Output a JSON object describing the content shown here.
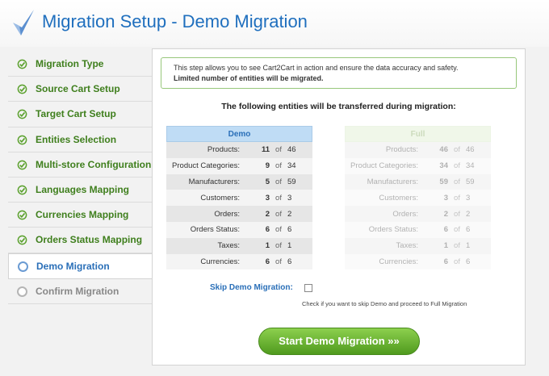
{
  "header": {
    "title": "Migration Setup - Demo Migration"
  },
  "sidebar": {
    "items": [
      {
        "label": "Migration Type",
        "state": "done"
      },
      {
        "label": "Source Cart Setup",
        "state": "done"
      },
      {
        "label": "Target Cart Setup",
        "state": "done"
      },
      {
        "label": "Entities Selection",
        "state": "done"
      },
      {
        "label": "Multi-store Configuration",
        "state": "done"
      },
      {
        "label": "Languages Mapping",
        "state": "done"
      },
      {
        "label": "Currencies Mapping",
        "state": "done"
      },
      {
        "label": "Orders Status Mapping",
        "state": "done"
      },
      {
        "label": "Demo Migration",
        "state": "active"
      },
      {
        "label": "Confirm Migration",
        "state": "pending"
      }
    ]
  },
  "notice": {
    "line1": "This step allows you to see Cart2Cart in action and ensure the data accuracy and safety.",
    "line2": "Limited number of entities will be migrated."
  },
  "subtitle": "The following entities will be transferred during migration:",
  "demo_table": {
    "header": "Demo",
    "rows": [
      {
        "label": "Products:",
        "value": "11",
        "of": "of",
        "total": "46"
      },
      {
        "label": "Product Categories:",
        "value": "9",
        "of": "of",
        "total": "34"
      },
      {
        "label": "Manufacturers:",
        "value": "5",
        "of": "of",
        "total": "59"
      },
      {
        "label": "Customers:",
        "value": "3",
        "of": "of",
        "total": "3"
      },
      {
        "label": "Orders:",
        "value": "2",
        "of": "of",
        "total": "2"
      },
      {
        "label": "Orders Status:",
        "value": "6",
        "of": "of",
        "total": "6"
      },
      {
        "label": "Taxes:",
        "value": "1",
        "of": "of",
        "total": "1"
      },
      {
        "label": "Currencies:",
        "value": "6",
        "of": "of",
        "total": "6"
      }
    ]
  },
  "full_table": {
    "header": "Full",
    "rows": [
      {
        "label": "Products:",
        "value": "46",
        "of": "of",
        "total": "46"
      },
      {
        "label": "Product Categories:",
        "value": "34",
        "of": "of",
        "total": "34"
      },
      {
        "label": "Manufacturers:",
        "value": "59",
        "of": "of",
        "total": "59"
      },
      {
        "label": "Customers:",
        "value": "3",
        "of": "of",
        "total": "3"
      },
      {
        "label": "Orders:",
        "value": "2",
        "of": "of",
        "total": "2"
      },
      {
        "label": "Orders Status:",
        "value": "6",
        "of": "of",
        "total": "6"
      },
      {
        "label": "Taxes:",
        "value": "1",
        "of": "of",
        "total": "1"
      },
      {
        "label": "Currencies:",
        "value": "6",
        "of": "of",
        "total": "6"
      }
    ]
  },
  "skip": {
    "label": "Skip Demo Migration:",
    "hint": "Check if you want to skip Demo and proceed to Full Migration",
    "checked": false
  },
  "start_button": {
    "label": "Start Demo Migration »»"
  },
  "colors": {
    "accent": "#1f6fbe",
    "success": "#3f7f1d",
    "button": "#5fae2a"
  }
}
